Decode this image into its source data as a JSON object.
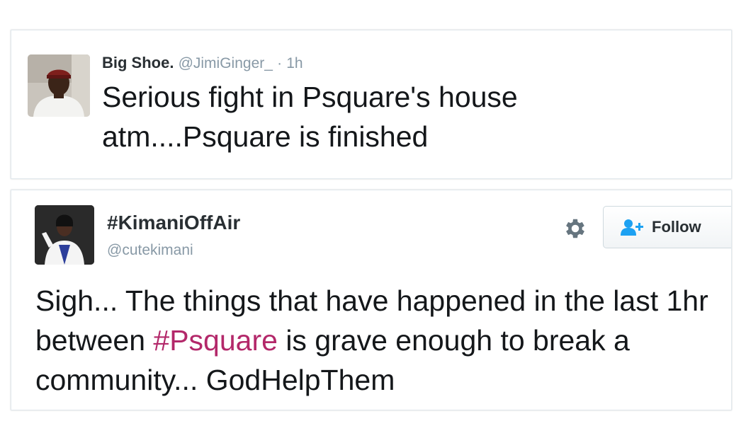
{
  "tweets": [
    {
      "avatar": "profile-photo-man-in-cap",
      "name": "Big Shoe.",
      "handle": "@JimiGinger_",
      "separator": "·",
      "time": "1h",
      "text": "Serious fight in Psquare's house atm....Psquare is finished"
    },
    {
      "avatar": "profile-photo-woman-in-white-blazer",
      "name": "#KimaniOffAir",
      "handle": "@cutekimani",
      "settings_icon": "gear-icon",
      "follow_icon": "add-user-icon",
      "follow_label": "Follow",
      "text_before": "Sigh... The things that have happened in the last 1hr between ",
      "hashtag": "#Psquare",
      "text_after": " is grave enough to break a community... GodHelpThem"
    }
  ],
  "colors": {
    "text": "#14171a",
    "muted": "#8899a6",
    "hashtag": "#b3286a",
    "border": "#e1e8ed"
  }
}
